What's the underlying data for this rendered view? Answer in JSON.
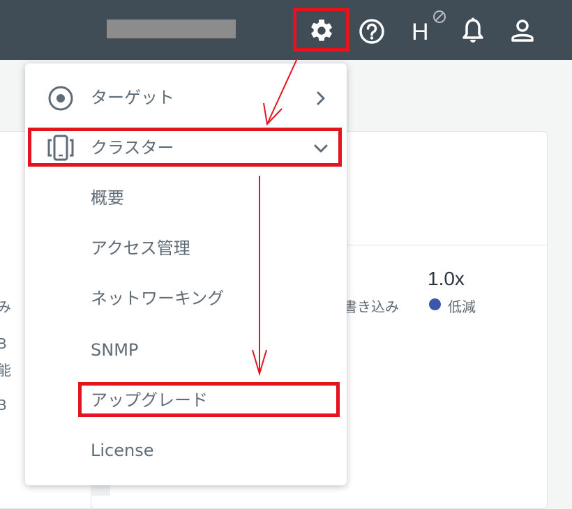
{
  "topbar": {
    "icons": [
      "moon-icon",
      "gear-icon",
      "help-icon",
      "h-status-icon",
      "bell-icon",
      "user-icon"
    ],
    "h_letter": "H"
  },
  "background": {
    "left_fragments": [
      "み",
      "B",
      "能",
      "B"
    ],
    "write_label": "書き込み",
    "ratio_value": "1.0x",
    "reduction_label": "低減",
    "legend_color": "#3c56a8"
  },
  "menu": {
    "items": [
      {
        "label": "ターゲット",
        "icon": "target-icon",
        "chevron": "right"
      },
      {
        "label": "クラスター",
        "icon": "cluster-icon",
        "chevron": "down"
      },
      {
        "label": "概要"
      },
      {
        "label": "アクセス管理"
      },
      {
        "label": "ネットワーキング"
      },
      {
        "label": "SNMP"
      },
      {
        "label": "アップグレード"
      },
      {
        "label": "License"
      }
    ]
  },
  "colors": {
    "topbar": "#404d57",
    "annotation_red": "#e3141f",
    "menu_text": "#5f6b76"
  }
}
